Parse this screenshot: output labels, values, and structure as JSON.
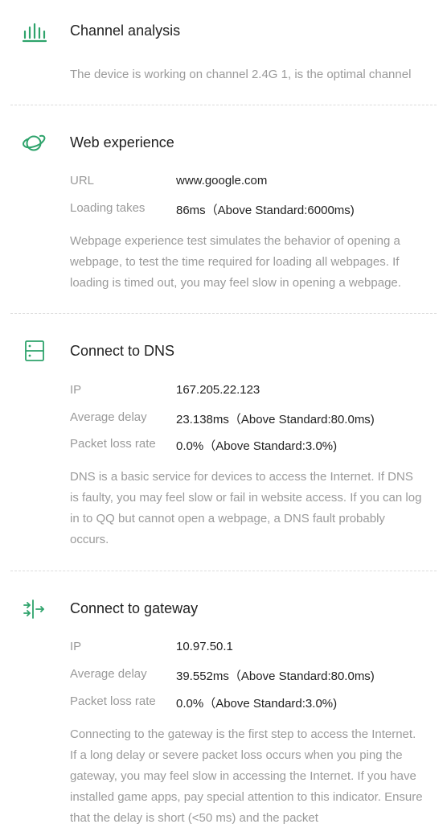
{
  "colors": {
    "accent": "#2ea36b",
    "title": "#222222",
    "secondary": "#9a9a9a",
    "divider": "#dcdcdc"
  },
  "channel": {
    "icon": "bar-chart-icon",
    "title": "Channel analysis",
    "description": "The device is working on channel 2.4G 1, is the optimal channel"
  },
  "web": {
    "icon": "planet-icon",
    "title": "Web experience",
    "url_label": "URL",
    "url_value": "www.google.com",
    "loading_label": "Loading takes",
    "loading_value": "86ms（Above Standard:6000ms)",
    "description": "Webpage experience test simulates the behavior of opening a webpage, to test the time required for loading all webpages. If loading is timed out, you may feel slow in opening a webpage."
  },
  "dns": {
    "icon": "server-icon",
    "title": "Connect to DNS",
    "ip_label": "IP",
    "ip_value": "167.205.22.123",
    "delay_label": "Average delay",
    "delay_value": "23.138ms（Above Standard:80.0ms)",
    "loss_label": "Packet loss rate",
    "loss_value": "0.0%（Above Standard:3.0%)",
    "description": "DNS is a basic service for devices to access the Internet. If DNS is faulty, you may feel slow or fail in website access. If you can log in to QQ but cannot open a webpage, a DNS fault probably occurs."
  },
  "gateway": {
    "icon": "gateway-arrows-icon",
    "title": "Connect to gateway",
    "ip_label": "IP",
    "ip_value": "10.97.50.1",
    "delay_label": "Average delay",
    "delay_value": "39.552ms（Above Standard:80.0ms)",
    "loss_label": "Packet loss rate",
    "loss_value": "0.0%（Above Standard:3.0%)",
    "description": "Connecting to the gateway is the first step to access the Internet. If a long delay or severe packet loss occurs when you ping the gateway, you may feel slow in accessing the Internet. If you have installed game apps, pay special attention to this indicator. Ensure that the delay is short (<50 ms) and the packet"
  }
}
